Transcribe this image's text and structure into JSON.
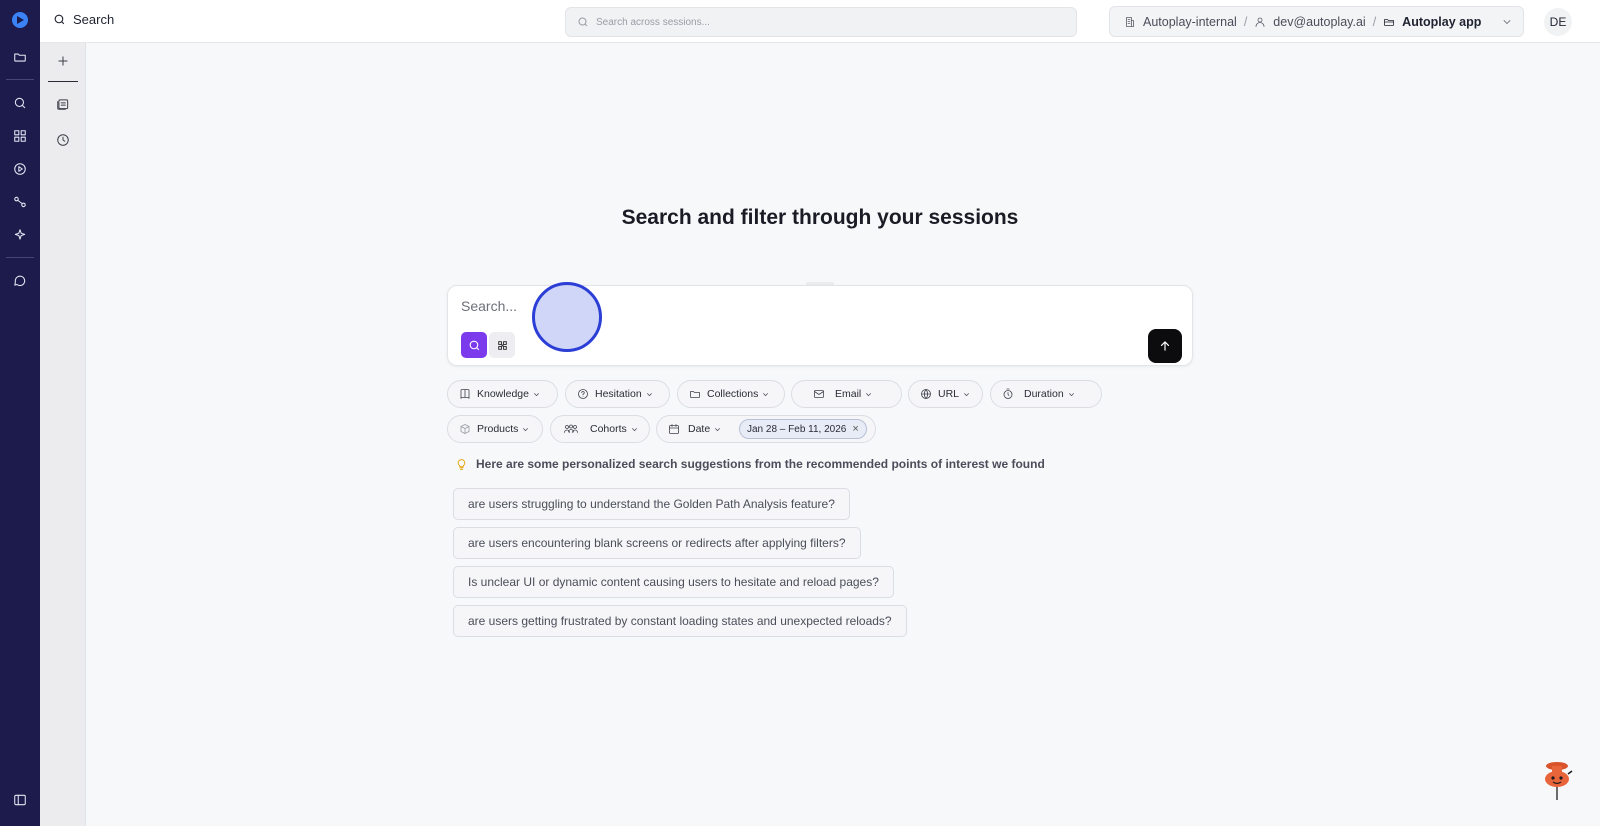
{
  "header": {
    "page_title": "Search",
    "global_search_placeholder": "Search across sessions...",
    "org": "Autoplay-internal",
    "user": "dev@autoplay.ai",
    "app": "Autoplay app",
    "avatar_initials": "DE"
  },
  "rail": {
    "icons": [
      "logo-icon",
      "folder-icon",
      "search-icon",
      "dashboard-icon",
      "play-circle-icon",
      "flow-icon",
      "sparkle-icon",
      "chat-icon",
      "sidebar-toggle-icon"
    ]
  },
  "sidebar": {
    "icons": [
      "plus-icon",
      "sessions-icon",
      "history-icon"
    ]
  },
  "main": {
    "heading": "Search and filter through your sessions",
    "search_placeholder": "Search...",
    "filters_row1": [
      {
        "label": "Knowledge",
        "icon": "book-icon"
      },
      {
        "label": "Hesitation",
        "icon": "question-icon"
      },
      {
        "label": "Collections",
        "icon": "folder-icon"
      },
      {
        "label": "Email",
        "icon": "mail-icon"
      },
      {
        "label": "URL",
        "icon": "globe-icon"
      },
      {
        "label": "Duration",
        "icon": "timer-icon"
      }
    ],
    "filters_row2": [
      {
        "label": "Products",
        "icon": "box-icon"
      },
      {
        "label": "Cohorts",
        "icon": "users-icon"
      },
      {
        "label": "Date",
        "icon": "calendar-icon"
      }
    ],
    "date_range": "Jan 28 – Feb 11, 2026",
    "suggestions_hint": "Here are some personalized search suggestions from the recommended points of interest we found",
    "suggestions": [
      "are users struggling to understand the Golden Path Analysis feature?",
      "are users encountering blank screens or redirects after applying filters?",
      "Is unclear UI or dynamic content causing users to hesitate and reload pages?",
      "are users getting frustrated by constant loading states and unexpected reloads?"
    ]
  },
  "colors": {
    "rail_bg": "#1c1b4b",
    "accent_purple": "#7c3aed",
    "send_button": "#0c0c0f"
  }
}
